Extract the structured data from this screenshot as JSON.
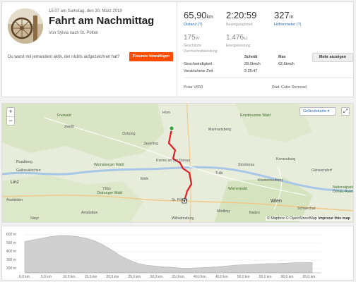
{
  "activity": {
    "date": "15:07 am Samstag, den 30. März 2019",
    "title": "Fahrt am Nachmittag",
    "from": "Von Sylvia nach St. Pölten",
    "nudge": "Du warst mit jemandem aktiv, der nichts aufgezeichnet hat?",
    "friends_button": "Freunde hinzufügen"
  },
  "stats": {
    "distance": {
      "value": "65,90",
      "unit": "km",
      "label": "Distanz (?)"
    },
    "moving_time": {
      "value": "2:20:59",
      "label": "Bewegungszeit"
    },
    "elevation": {
      "value": "327",
      "unit": "m",
      "label": "Höhenmeter (?)"
    },
    "power": {
      "value": "175",
      "unit": "W",
      "label1": "Geschätzte",
      "label2": "Durchschnittsleistung"
    },
    "energy": {
      "value": "1.476",
      "unit": "kJ",
      "label": "Energieleistung"
    },
    "more_button": "Mehr anzeigen",
    "table": {
      "col1": "Schnitt",
      "col2": "Max",
      "rows": [
        {
          "label": "Geschwindigkeit",
          "avg": "28,0km/h",
          "max": "62,6km/h"
        },
        {
          "label": "Verstrichene Zeit",
          "avg": "2:25:47",
          "max": ""
        }
      ]
    },
    "device": "Polar V650",
    "bike": "Rad: Cube Rennrad"
  },
  "map": {
    "zoom_in": "+",
    "zoom_out": "−",
    "type_button": "Geländekarte",
    "type_chevron": "▾",
    "expand_icon": "⤢",
    "attribution": "© Mapbox © OpenStreetMap",
    "improve": "Improve this map",
    "labels": [
      {
        "text": "Horn",
        "cls": ""
      },
      {
        "text": "Freiwald",
        "cls": "lbl-green"
      },
      {
        "text": "Weinsberger Wald",
        "cls": "lbl-green"
      },
      {
        "text": "Jauerling",
        "cls": ""
      },
      {
        "text": "Ostrong",
        "cls": ""
      },
      {
        "text": "Zwettl",
        "cls": ""
      },
      {
        "text": "Ernstbrunner Wald",
        "cls": "lbl-green"
      },
      {
        "text": "Manhartsberg",
        "cls": ""
      },
      {
        "text": "Stockerau",
        "cls": ""
      },
      {
        "text": "Gänserndorf",
        "cls": ""
      },
      {
        "text": "Korneuburg",
        "cls": ""
      },
      {
        "text": "Krems an der Donau",
        "cls": ""
      },
      {
        "text": "Tulln",
        "cls": ""
      },
      {
        "text": "Klosterneuburg",
        "cls": ""
      },
      {
        "text": "Wienerwald",
        "cls": "lbl-green"
      },
      {
        "text": "Wien",
        "cls": ""
      },
      {
        "text": "Schwechat",
        "cls": ""
      },
      {
        "text": "Nationalpark Donau-Auen",
        "cls": "lbl-green"
      },
      {
        "text": "Linz",
        "cls": ""
      },
      {
        "text": "Roadberg",
        "cls": ""
      },
      {
        "text": "Gallneukirchen",
        "cls": ""
      },
      {
        "text": "Amstetten",
        "cls": ""
      },
      {
        "text": "Ybbs",
        "cls": ""
      },
      {
        "text": "Melk",
        "cls": ""
      },
      {
        "text": "St. Pölten",
        "cls": ""
      },
      {
        "text": "Wilhelmsburg",
        "cls": ""
      },
      {
        "text": "Ansfelden",
        "cls": ""
      },
      {
        "text": "Steyr",
        "cls": ""
      },
      {
        "text": "Ostronger Wald",
        "cls": "lbl-green"
      },
      {
        "text": "Baden",
        "cls": ""
      },
      {
        "text": "Mödling",
        "cls": ""
      }
    ]
  },
  "elevation": {
    "y_ticks": [
      "600 m",
      "500 m",
      "400 m",
      "300 m",
      "200 m"
    ],
    "x_ticks": [
      "0,0 km",
      "5,0 km",
      "10,0 km",
      "15,0 km",
      "20,0 km",
      "25,0 km",
      "30,0 km",
      "35,0 km",
      "40,0 km",
      "45,0 km",
      "50,0 km",
      "55,0 km",
      "60,0 km",
      "65,0 km"
    ],
    "profile_km": [
      0,
      2,
      4,
      6,
      8,
      10,
      12,
      14,
      16,
      18,
      20,
      22,
      24,
      26,
      28,
      30,
      32,
      34,
      36,
      38,
      40,
      42,
      44,
      46,
      48,
      50,
      52,
      54,
      56,
      58,
      60,
      62,
      64,
      65.9
    ],
    "profile_m": [
      520,
      540,
      560,
      580,
      590,
      590,
      580,
      560,
      530,
      480,
      420,
      350,
      300,
      260,
      240,
      230,
      220,
      215,
      205,
      205,
      210,
      215,
      220,
      230,
      240,
      245,
      250,
      255,
      260,
      260,
      265,
      270,
      270,
      272
    ],
    "y_min": 150,
    "y_max": 650,
    "x_max": 68
  }
}
